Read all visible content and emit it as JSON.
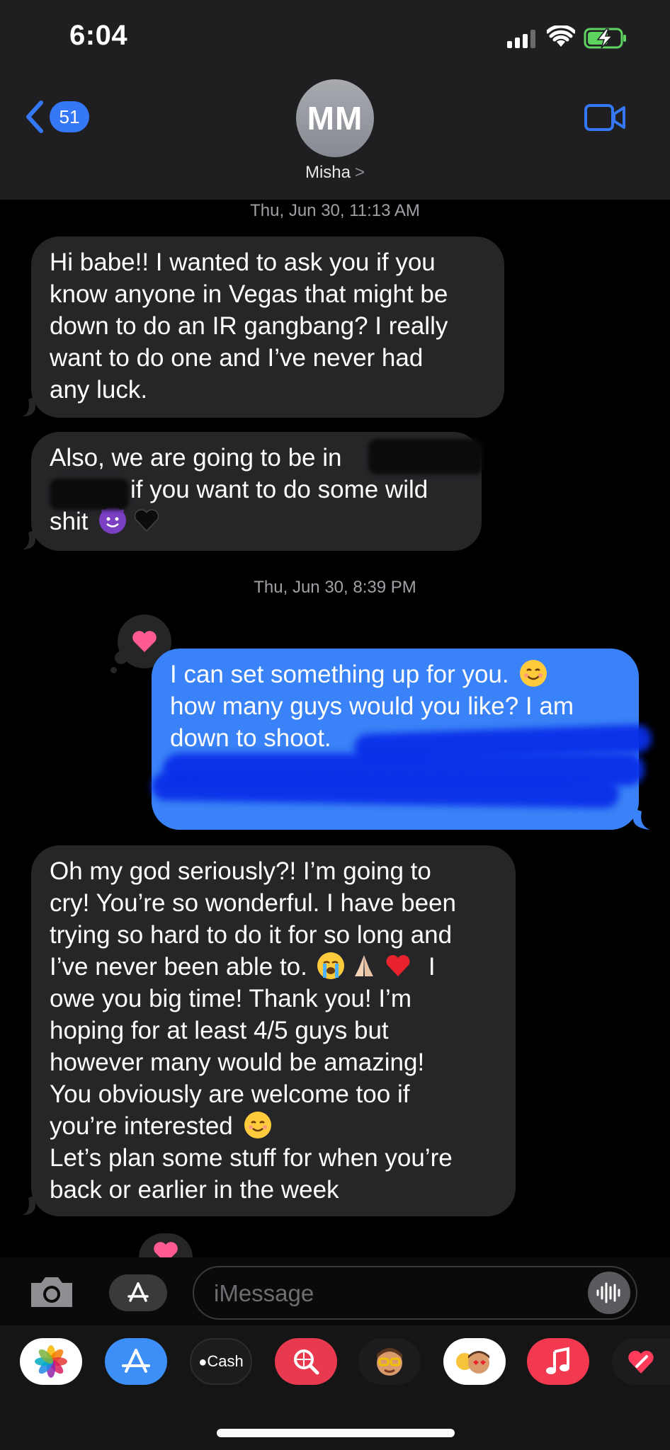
{
  "status_bar": {
    "time": "6:04"
  },
  "header": {
    "back_count": "51",
    "avatar_initials": "MM",
    "contact_name": "Misha",
    "contact_chevron": ">"
  },
  "timestamps": [
    "Thu, Jun 30, 11:13 AM",
    "Thu, Jun 30, 8:39 PM"
  ],
  "messages": [
    {
      "direction": "incoming",
      "lines": [
        "Hi babe!! I wanted to ask you if you",
        "know anyone in Vegas that might be",
        "down to do an IR gangbang? I really",
        "want to do one and I’ve never had",
        "any luck."
      ]
    },
    {
      "direction": "incoming",
      "line1": "Also, we are going to be in",
      "line2": "if you want to do some wild",
      "line3": "shit"
    },
    {
      "direction": "outgoing",
      "lines": [
        "I can set something up for you.",
        "how many guys would you like? I am",
        "down to shoot."
      ]
    },
    {
      "direction": "incoming",
      "lines": [
        "Oh my god seriously?! I’m going to",
        "cry! You’re so wonderful. I have been",
        "trying so hard to do it for so long and",
        "I’ve never been able to.",
        "owe you big time! Thank you! I’m",
        "hoping for at least 4/5 guys but",
        "however many would be amazing!",
        "You obviously are welcome too if",
        "you’re interested",
        "Let’s plan some stuff for when you’re",
        "back or earlier in the week"
      ],
      "line4_tail": "I"
    }
  ],
  "input": {
    "placeholder": "iMessage"
  },
  "app_drawer": [
    {
      "name": "Photos",
      "icon": "photos-icon"
    },
    {
      "name": "App Store",
      "icon": "app-store-icon"
    },
    {
      "name": "Cash",
      "label": "Cash",
      "icon": "apple-cash-icon"
    },
    {
      "name": "Search",
      "icon": "web-search-icon"
    },
    {
      "name": "Memoji",
      "icon": "memoji-icon"
    },
    {
      "name": "Memoji Stickers",
      "icon": "memoji-stickers-icon"
    },
    {
      "name": "Music",
      "icon": "music-icon"
    },
    {
      "name": "Digital Touch",
      "icon": "digital-touch-icon"
    }
  ],
  "colors": {
    "outgoing_bubble": "#3a82f7",
    "incoming_bubble": "#262629",
    "tapback_heart": "#ff5a93",
    "accent": "#3478f6"
  }
}
